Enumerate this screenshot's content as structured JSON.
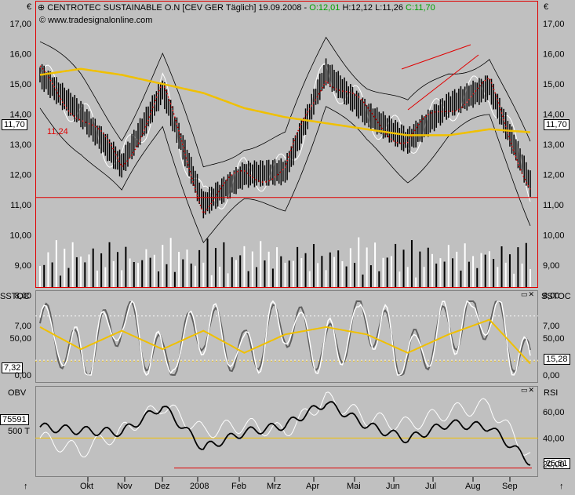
{
  "header": {
    "instrument": "CENTROTEC SUSTAINABLE O.N [CEV GER  Täglich] 19.09.2008",
    "open": "O:12,01",
    "high": "H:12,12",
    "low": "L:11,26",
    "close": "C:11,70",
    "watermark": "www.tradesignalonline.com",
    "currency_symbol": "€"
  },
  "price_panel": {
    "y_ticks": [
      "17,00",
      "16,00",
      "15,00",
      "14,00",
      "13,00",
      "12,00",
      "11,00",
      "10,00",
      "9,00",
      "8,00",
      "7,00"
    ],
    "last_price_label": "11,70",
    "support_label": "11,24"
  },
  "stoch_panel": {
    "left_title": "SSTOC",
    "right_title": "SSTOC",
    "y_ticks": [
      "50,00",
      "0,00"
    ],
    "left_value": "7,32",
    "right_value": "15,28"
  },
  "obv_panel": {
    "left_title": "OBV",
    "right_title": "RSI",
    "left_value": "75591",
    "left_tick": "500 T",
    "rsi_ticks": [
      "60,00",
      "40,00",
      "20,00"
    ],
    "rsi_value": "25,51"
  },
  "x_axis": {
    "labels": [
      "Okt",
      "Nov",
      "Dez",
      "2008",
      "Feb",
      "Mrz",
      "Apr",
      "Mai",
      "Jun",
      "Jul",
      "Aug",
      "Sep"
    ]
  },
  "colors": {
    "background": "#c0c0c0",
    "sma": "#f0c000",
    "bollinger": "#000000",
    "support": "#e00000",
    "ma_dots": "#e00000",
    "white_line": "#ffffff"
  },
  "chart_data": [
    {
      "type": "line",
      "title": "CENTROTEC SUSTAINABLE O.N [CEV GER  Täglich] 19.09.2008",
      "ylim": [
        7,
        17.5
      ],
      "x": [
        "2007-09",
        "2007-10",
        "2007-11",
        "2007-12",
        "2008-01",
        "2008-02",
        "2008-03",
        "2008-04",
        "2008-05",
        "2008-06",
        "2008-07",
        "2008-08",
        "2008-09"
      ],
      "series": [
        {
          "name": "Close",
          "values": [
            15.3,
            14.0,
            12.3,
            14.8,
            11.0,
            12.0,
            12.1,
            15.4,
            14.0,
            13.1,
            14.3,
            14.9,
            11.7
          ]
        },
        {
          "name": "SMA",
          "values": [
            15.3,
            15.5,
            15.3,
            15.0,
            14.7,
            14.2,
            13.9,
            13.7,
            13.5,
            13.3,
            13.3,
            13.5,
            13.4
          ]
        }
      ],
      "support_level": 11.24,
      "last": 11.7
    },
    {
      "type": "line",
      "title": "SSTOC",
      "ylim": [
        0,
        100
      ],
      "x": [
        "2007-09",
        "2007-10",
        "2007-11",
        "2007-12",
        "2008-01",
        "2008-02",
        "2008-03",
        "2008-04",
        "2008-05",
        "2008-06",
        "2008-07",
        "2008-08",
        "2008-09"
      ],
      "series": [
        {
          "name": "SSTOC",
          "values": [
            70,
            20,
            80,
            15,
            70,
            25,
            75,
            30,
            80,
            20,
            65,
            85,
            7.32
          ]
        },
        {
          "name": "Signal",
          "values": [
            65,
            35,
            60,
            35,
            60,
            30,
            55,
            65,
            55,
            30,
            55,
            75,
            15.28
          ]
        }
      ]
    },
    {
      "type": "line",
      "title": "OBV / RSI",
      "x": [
        "2007-09",
        "2007-10",
        "2007-11",
        "2007-12",
        "2008-01",
        "2008-02",
        "2008-03",
        "2008-04",
        "2008-05",
        "2008-06",
        "2008-07",
        "2008-08",
        "2008-09"
      ],
      "series": [
        {
          "name": "OBV",
          "values": [
            500,
            480,
            470,
            620,
            380,
            470,
            510,
            640,
            510,
            430,
            520,
            500,
            300
          ]
        },
        {
          "name": "RSI",
          "values": [
            40,
            30,
            45,
            65,
            45,
            50,
            45,
            70,
            55,
            50,
            60,
            65,
            25.51
          ]
        }
      ]
    }
  ]
}
